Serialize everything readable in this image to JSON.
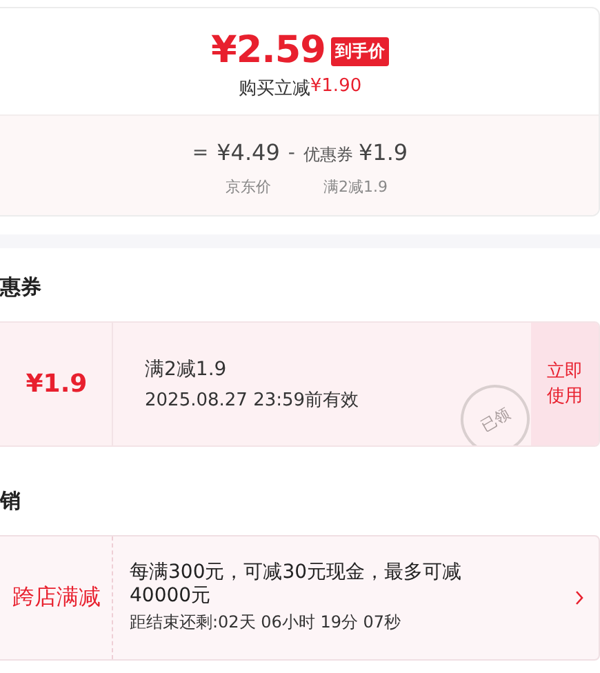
{
  "price_card": {
    "price": "¥2.59",
    "badge": "到手价",
    "saving_label": "购买立减",
    "saving_amount": "¥1.90",
    "breakdown": [
      {
        "op": "=",
        "amount": "¥4.49",
        "caption": "京东价"
      },
      {
        "op": "-",
        "prefix": "优惠券",
        "amount": "¥1.9",
        "caption": "满2减1.9"
      }
    ]
  },
  "coupon_section": {
    "title": "惠券",
    "coupon": {
      "amount": "¥1.9",
      "condition": "满2减1.9",
      "validity": "2025.08.27 23:59前有效",
      "stamp": "已领",
      "action": "立即使用"
    }
  },
  "promo_section": {
    "title": "销",
    "promo": {
      "type": "跨店满减",
      "description": "每满300元，可减30元现金，最多可减40000元",
      "countdown": "距结束还剩:02天 06小时 19分 07秒"
    }
  }
}
